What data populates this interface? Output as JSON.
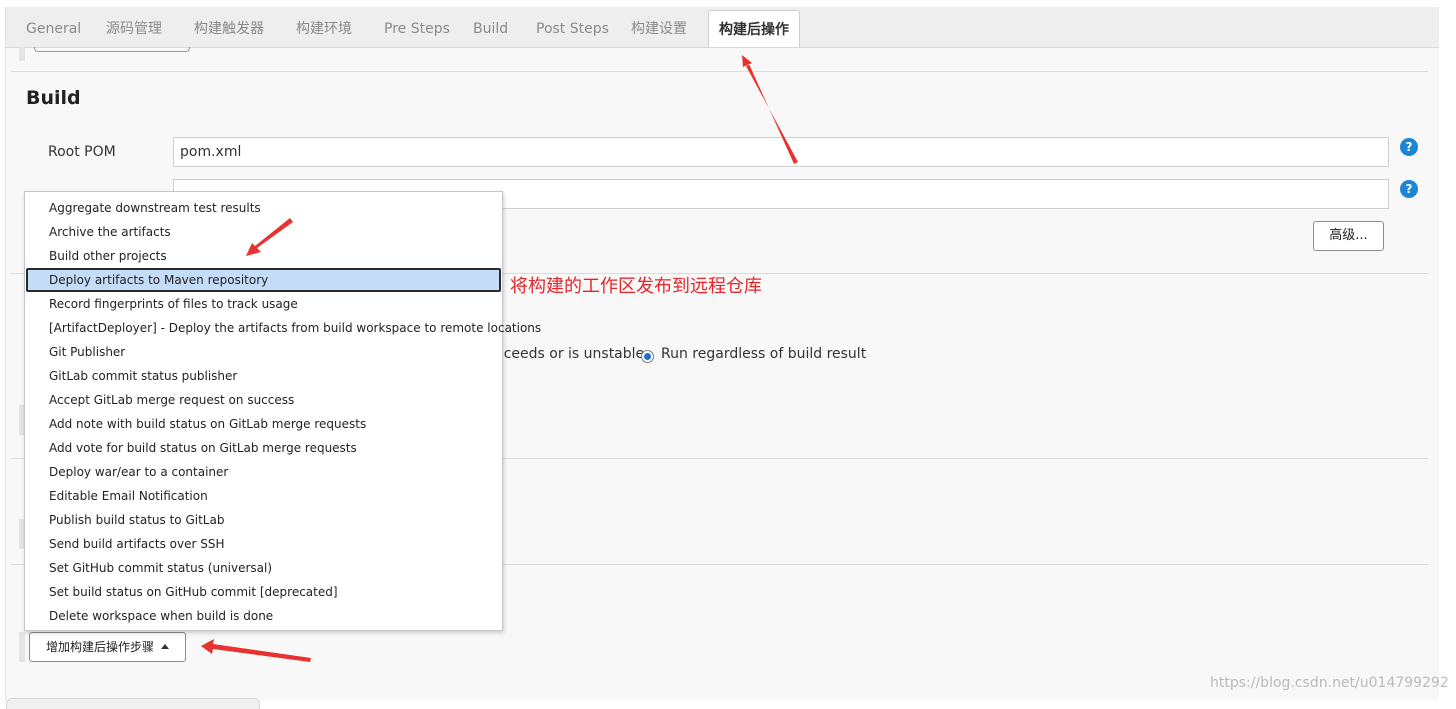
{
  "tabs": [
    {
      "label": "General"
    },
    {
      "label": "源码管理"
    },
    {
      "label": "构建触发器"
    },
    {
      "label": "构建环境"
    },
    {
      "label": "Pre Steps"
    },
    {
      "label": "Build"
    },
    {
      "label": "Post Steps"
    },
    {
      "label": "构建设置"
    },
    {
      "label": "构建后操作",
      "active": true
    }
  ],
  "build": {
    "title": "Build",
    "root_pom_label": "Root POM",
    "root_pom_value": "pom.xml",
    "goals_value": "",
    "advanced_label": "高级..."
  },
  "post_steps": {
    "fragment_text": "cceeds or is unstable",
    "run_regardless_label": "Run regardless of build result"
  },
  "dropdown": {
    "items": [
      {
        "label": "Aggregate downstream test results"
      },
      {
        "label": "Archive the artifacts"
      },
      {
        "label": "Build other projects"
      },
      {
        "label": "Deploy artifacts to Maven repository",
        "selected": true
      },
      {
        "label": "Record fingerprints of files to track usage"
      },
      {
        "label": "[ArtifactDeployer] - Deploy the artifacts from build workspace to remote locations"
      },
      {
        "label": "Git Publisher"
      },
      {
        "label": "GitLab commit status publisher"
      },
      {
        "label": "Accept GitLab merge request on success"
      },
      {
        "label": "Add note with build status on GitLab merge requests"
      },
      {
        "label": "Add vote for build status on GitLab merge requests"
      },
      {
        "label": "Deploy war/ear to a container"
      },
      {
        "label": "Editable Email Notification"
      },
      {
        "label": "Publish build status to GitLab"
      },
      {
        "label": "Send build artifacts over SSH"
      },
      {
        "label": "Set GitHub commit status (universal)"
      },
      {
        "label": "Set build status on GitHub commit [deprecated]"
      },
      {
        "label": "Delete workspace when build is done"
      }
    ]
  },
  "add_post_build_step_label": "增加构建后操作步骤",
  "annotation": "将构建的工作区发布到远程仓库",
  "watermark": "https://blog.csdn.net/u014799292",
  "colors": {
    "accent": "#1d85d6",
    "annotation_red": "#e4262b",
    "selected_bg": "#c3dcf7"
  },
  "icons": {
    "help": "help-icon",
    "caret": "caret-up-icon",
    "radio": "radio-selected-icon"
  }
}
